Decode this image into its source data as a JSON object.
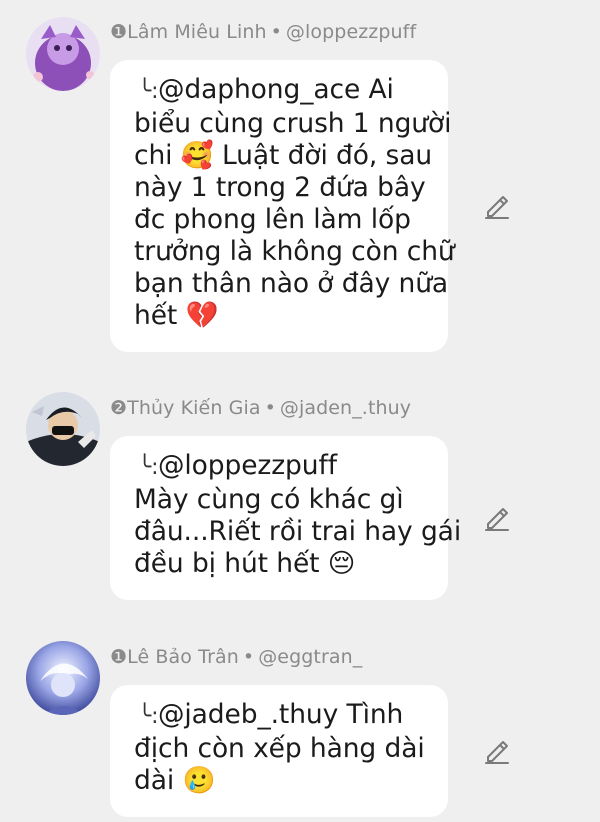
{
  "messages": [
    {
      "rank": "❶",
      "name": "Lâm Miêu Linh",
      "sep": "•",
      "handle": "@loppezzpuff",
      "reply_prefix": "╰: ",
      "lines": [
        "@daphong_ace Ai",
        "biểu cùng crush 1 người",
        "chi 🥰 Luật đời đó, sau",
        "này 1 trong 2 đứa bây",
        "đc phong lên làm lốp",
        "trưởng là không còn chữ",
        "bạn thân nào ở đây nữa",
        "hết 💔"
      ]
    },
    {
      "rank": "❷",
      "name": "Thủy Kiến Gia",
      "sep": "•",
      "handle": "@jaden_.thuy",
      "reply_prefix": "╰: ",
      "lines": [
        "@loppezzpuff",
        "Mày cùng có khác gì",
        "đâu...Riết rồi trai hay gái",
        "đều bị hút hết 😔"
      ]
    },
    {
      "rank": "❶",
      "name": "Lê Bảo Trân",
      "sep": "•",
      "handle": "@eggtran_",
      "reply_prefix": "╰: ",
      "lines": [
        "@jadeb_.thuy Tình",
        "địch còn xếp hàng dài",
        "dài 🥲"
      ]
    }
  ],
  "icons": {
    "edit": "pencil-icon"
  },
  "colors": {
    "background": "#efefef",
    "bubble": "#ffffff",
    "meta_text": "#8a8a8a",
    "body_text": "#1b1b1b"
  }
}
